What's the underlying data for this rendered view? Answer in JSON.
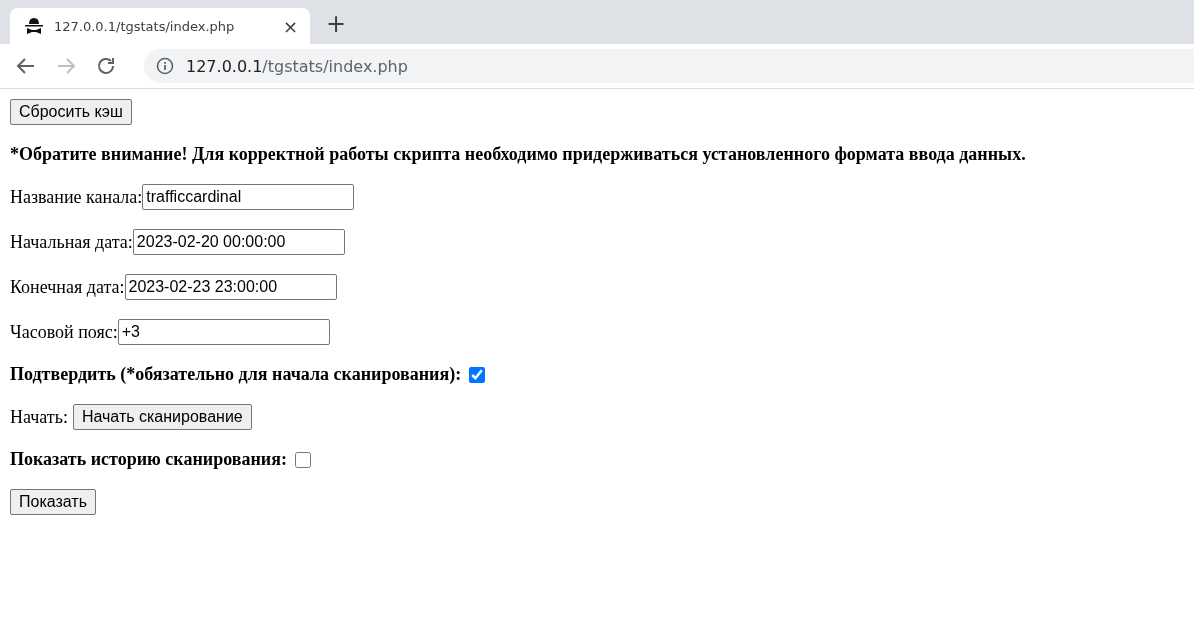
{
  "browser": {
    "tab": {
      "title": "127.0.0.1/tgstats/index.php",
      "close": "×",
      "new_tab": "+"
    },
    "address": {
      "host": "127.0.0.1",
      "path": "/tgstats/index.php"
    }
  },
  "form": [
    {
      "kind": "button",
      "label": "Сбросить кэш"
    },
    {
      "kind": "notice",
      "text": "*Обратите внимание! Для корректной работы скрипта необходимо придерживаться установленного формата ввода данных."
    },
    {
      "kind": "field",
      "label": "Название канала:",
      "value": "trafficcardinal"
    },
    {
      "kind": "field",
      "label": "Начальная дата:",
      "value": "2023-02-20 00:00:00"
    },
    {
      "kind": "field",
      "label": "Конечная дата:",
      "value": "2023-02-23 23:00:00"
    },
    {
      "kind": "field",
      "label": "Часовой пояс:",
      "value": "+3"
    },
    {
      "kind": "checkbox",
      "label": "Подтвердить (*обязательно для начала сканирования):",
      "checked": true
    },
    {
      "kind": "labeled_button",
      "label": "Начать:",
      "button": "Начать сканирование"
    },
    {
      "kind": "checkbox",
      "label": "Показать историю сканирования:",
      "checked": false
    },
    {
      "kind": "button",
      "label": "Показать"
    }
  ]
}
